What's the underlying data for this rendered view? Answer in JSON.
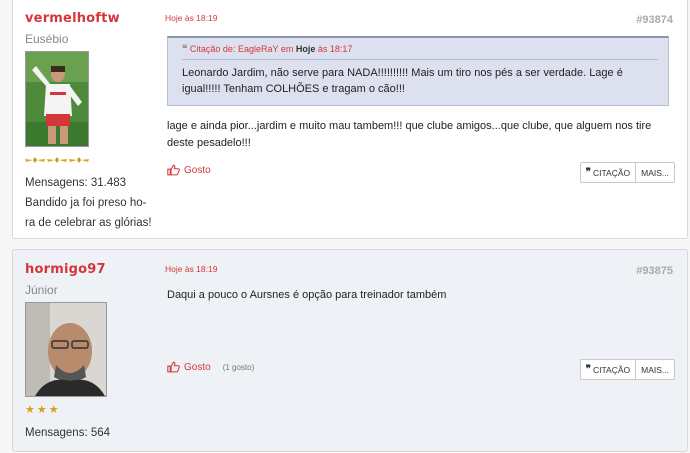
{
  "posts": [
    {
      "username": "vermelhoftw",
      "rank": "Eusébio",
      "stars_count": 3,
      "stats_label": "Mensagens: 31.483",
      "bio": "Bandido ja foi preso ho-ra de celebrar as glórias!",
      "date": "Hoje às 18:19",
      "post_number": "#93874",
      "quote": {
        "prefix": "Citação de: ",
        "author": "EagleRaY",
        "sep1": " em ",
        "when": "Hoje",
        "sep2": " às 18:17",
        "text": "Leonardo Jardim, não serve para NADA!!!!!!!!!! Mais um tiro nos pés a ser verdade. Lage é igual!!!!! Tenham COLHÕES e tragam o cão!!!"
      },
      "body": "lage e ainda pior...jardim e muito mau tambem!!! que clube amigos...que clube, que alguem nos tire deste pesadelo!!!",
      "like_label": "Gosto",
      "like_count": "",
      "quote_button": "CITAÇÃO",
      "more_button": "MAIS..."
    },
    {
      "username": "hormigo97",
      "rank": "Júnior",
      "stars_count": 3,
      "stats_label": "Mensagens: 564",
      "date": "Hoje às 18:19",
      "post_number": "#93875",
      "body": "Daqui a pouco o Aursnes é opção para treinador também",
      "like_label": "Gosto",
      "like_count": "(1 gosto)",
      "quote_button": "CITAÇÃO",
      "more_button": "MAIS..."
    }
  ],
  "colors": {
    "accent": "#d4373a",
    "quote_bg": "#dde0ee",
    "post2_bg": "#eef1f5"
  },
  "icons": {
    "like": "thumbs-up-icon",
    "quote": "quote-mark-icon",
    "rank": "star-icon"
  }
}
